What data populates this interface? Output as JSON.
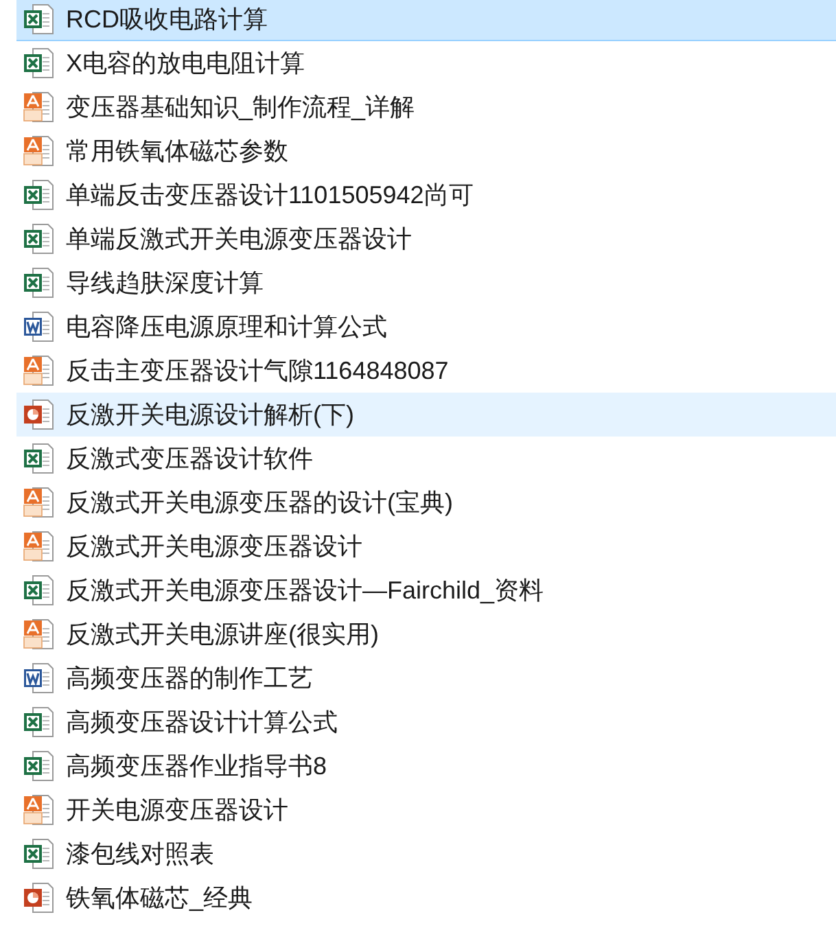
{
  "files": [
    {
      "name": "RCD吸收电路计算",
      "kind": "spreadsheet",
      "selected": true,
      "hovered": false
    },
    {
      "name": "X电容的放电电阻计算",
      "kind": "spreadsheet",
      "selected": false,
      "hovered": false
    },
    {
      "name": "变压器基础知识_制作流程_详解",
      "kind": "pdf",
      "selected": false,
      "hovered": false
    },
    {
      "name": "常用铁氧体磁芯参数",
      "kind": "pdf",
      "selected": false,
      "hovered": false
    },
    {
      "name": "单端反击变压器设计1101505942尚可",
      "kind": "spreadsheet",
      "selected": false,
      "hovered": false
    },
    {
      "name": "单端反激式开关电源变压器设计",
      "kind": "spreadsheet",
      "selected": false,
      "hovered": false
    },
    {
      "name": "导线趋肤深度计算",
      "kind": "spreadsheet",
      "selected": false,
      "hovered": false
    },
    {
      "name": "电容降压电源原理和计算公式",
      "kind": "document",
      "selected": false,
      "hovered": false
    },
    {
      "name": "反击主变压器设计气隙1164848087",
      "kind": "pdf",
      "selected": false,
      "hovered": false
    },
    {
      "name": "反激开关电源设计解析(下)",
      "kind": "presentation",
      "selected": false,
      "hovered": true
    },
    {
      "name": "反激式变压器设计软件",
      "kind": "spreadsheet",
      "selected": false,
      "hovered": false
    },
    {
      "name": "反激式开关电源变压器的设计(宝典)",
      "kind": "pdf",
      "selected": false,
      "hovered": false
    },
    {
      "name": "反激式开关电源变压器设计",
      "kind": "pdf",
      "selected": false,
      "hovered": false
    },
    {
      "name": "反激式开关电源变压器设计—Fairchild_资料",
      "kind": "spreadsheet",
      "selected": false,
      "hovered": false
    },
    {
      "name": "反激式开关电源讲座(很实用)",
      "kind": "pdf",
      "selected": false,
      "hovered": false
    },
    {
      "name": "高频变压器的制作工艺",
      "kind": "document",
      "selected": false,
      "hovered": false
    },
    {
      "name": "高频变压器设计计算公式",
      "kind": "spreadsheet",
      "selected": false,
      "hovered": false
    },
    {
      "name": "高频变压器作业指导书8",
      "kind": "spreadsheet",
      "selected": false,
      "hovered": false
    },
    {
      "name": "开关电源变压器设计",
      "kind": "pdf",
      "selected": false,
      "hovered": false
    },
    {
      "name": "漆包线对照表",
      "kind": "spreadsheet",
      "selected": false,
      "hovered": false
    },
    {
      "name": "铁氧体磁芯_经典",
      "kind": "presentation",
      "selected": false,
      "hovered": false
    }
  ]
}
